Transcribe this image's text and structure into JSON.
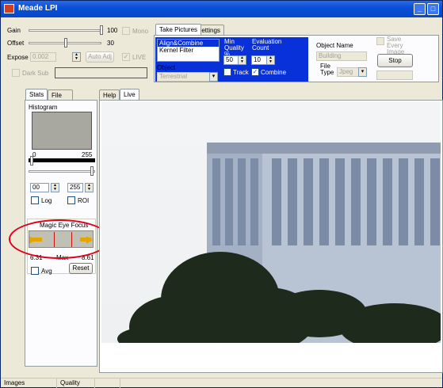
{
  "window": {
    "title": "Meade LPI"
  },
  "camera": {
    "gain_label": "Gain",
    "gain_value": "100",
    "mono_label": "Mono",
    "offset_label": "Offset",
    "offset_value": "30",
    "expose_label": "Expose",
    "expose_value": "0.002",
    "auto_adj_label": "Auto Adj",
    "live_label": "LIVE",
    "dark_sub_label": "Dark Sub"
  },
  "tabs_top": {
    "take_pictures": "Take Pictures",
    "settings": "Settings"
  },
  "take_pictures": {
    "modes": [
      "Align&Combine",
      "Kernel Filter"
    ],
    "min_quality_label": "Min Quality %",
    "min_quality_value": "50",
    "eval_count_label": "Evaluation Count",
    "eval_count_value": "10",
    "track_label": "Track",
    "combine_label": "Combine",
    "object_label": "Object",
    "object_value": "Terrestrial",
    "object_name_label": "Object Name",
    "object_name_value": "Building",
    "file_type_label": "File Type",
    "file_type_value": "Jpeg",
    "save_every_label": "Save Every Image",
    "stop_label": "Stop"
  },
  "left_tabs": {
    "stats": "Stats",
    "file": "File"
  },
  "stats": {
    "histogram_label": "Histogram",
    "hist_min": "0",
    "hist_max": "255",
    "low_value": "00",
    "high_value": "255",
    "log_label": "Log",
    "roi_label": "ROI",
    "magic_eye_label": "Magic Eye Focus",
    "focus_current": "6.31",
    "focus_max_label": "Max",
    "focus_max": "8.61",
    "avg_label": "Avg",
    "reset_label": "Reset"
  },
  "view_tabs": {
    "help": "Help",
    "live": "Live"
  },
  "status": {
    "images": "Images",
    "quality": "Quality"
  },
  "colors": {
    "title_bar": "#0a4fd6",
    "selection_panel": "#0831d9",
    "annotation_circle": "#e0001a",
    "focus_bar": "#e6a400"
  }
}
